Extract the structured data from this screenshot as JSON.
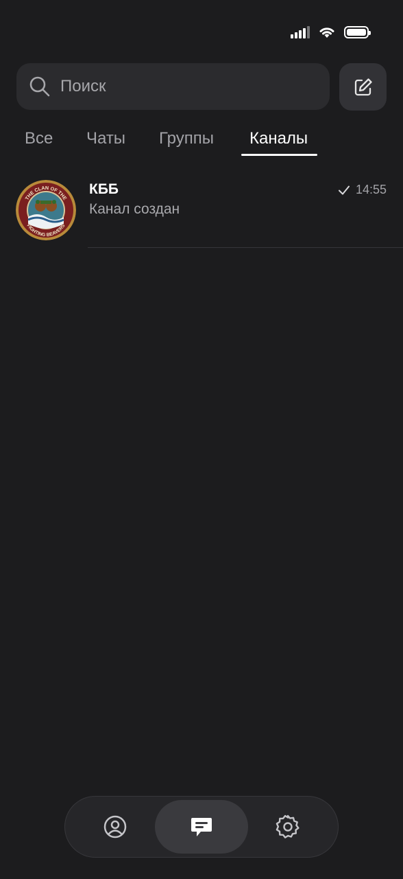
{
  "search": {
    "placeholder": "Поиск"
  },
  "tabs": [
    {
      "label": "Все"
    },
    {
      "label": "Чаты"
    },
    {
      "label": "Группы"
    },
    {
      "label": "Каналы",
      "active": true
    }
  ],
  "chats": [
    {
      "name": "КББ",
      "last_message": "Канал создан",
      "time": "14:55",
      "read_status": "check-icon",
      "avatar_text_top": "THE CLAN OF THE",
      "avatar_text_bottom": "FIGHTING BEAVERS"
    }
  ],
  "bottom_nav": {
    "items": [
      {
        "icon": "profile-icon"
      },
      {
        "icon": "chats-icon",
        "active": true
      },
      {
        "icon": "settings-icon"
      }
    ]
  },
  "colors": {
    "background": "#1c1c1e",
    "surface": "#2b2b2e",
    "accent": "#ffffff",
    "secondary_text": "#a3a3a8"
  }
}
